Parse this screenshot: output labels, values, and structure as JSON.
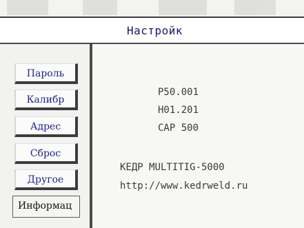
{
  "header": {
    "title": "Настройк"
  },
  "sidebar": {
    "tabs": [
      {
        "label": "Пароль",
        "active": false
      },
      {
        "label": "Калибр",
        "active": false
      },
      {
        "label": "Адрес",
        "active": false
      },
      {
        "label": "Сброс",
        "active": false
      },
      {
        "label": "Другое",
        "active": false
      },
      {
        "label": "Информац",
        "active": true
      }
    ]
  },
  "info": {
    "line1": "P50.001",
    "line2": "H01.201",
    "line3": "CAP 500",
    "device": "КЕДР MULTITIG-5000",
    "website": "http://www.kedrweld.ru"
  },
  "colors": {
    "title_text": "#15176a",
    "tab_text": "#1c1f8a",
    "frame_dark": "#3c3c3c"
  }
}
